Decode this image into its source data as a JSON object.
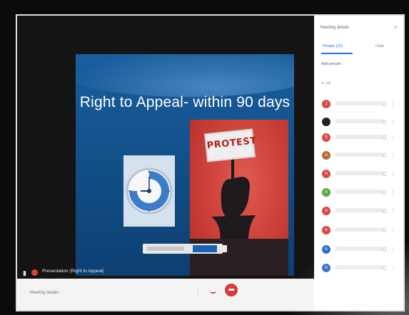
{
  "slide": {
    "title": "Right to Appeal- within 90 days",
    "poster_text": "PROTEST"
  },
  "notification": {
    "text": "Presentation (Right to Appeal)"
  },
  "participants_panel": {
    "title": "Meeting details",
    "people_tab": "People (11)",
    "chat_tab": "Chat",
    "add_people": "Add people",
    "section_label": "In call",
    "participants": [
      {
        "initial": "J",
        "color": "#d94a45"
      },
      {
        "initial": "",
        "color": "#222222"
      },
      {
        "initial": "S",
        "color": "#d94a45"
      },
      {
        "initial": "A",
        "color": "#b86a3a"
      },
      {
        "initial": "A",
        "color": "#d94a45"
      },
      {
        "initial": "A",
        "color": "#5aa83d"
      },
      {
        "initial": "A",
        "color": "#d94a45"
      },
      {
        "initial": "A",
        "color": "#d94a45"
      },
      {
        "initial": "A",
        "color": "#2f6fc9"
      },
      {
        "initial": "A",
        "color": "#2f6fc9"
      }
    ]
  },
  "controls": {
    "meeting_details": "Meeting details"
  },
  "colors": {
    "slide_blue": "#1a5e9d",
    "poster_red": "#c63a34",
    "accent_blue": "#1a73e8",
    "leave_red": "#d93a3a"
  }
}
